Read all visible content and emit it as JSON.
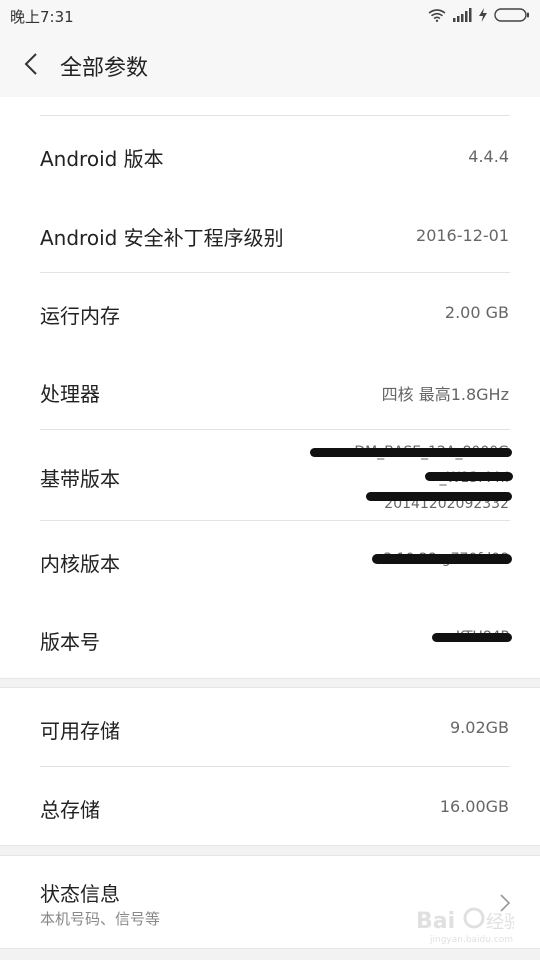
{
  "status_bar": {
    "time": "晚上7:31",
    "icons": [
      "wifi-icon",
      "signal-icon",
      "charging-icon",
      "battery-icon"
    ]
  },
  "header": {
    "title": "全部参数",
    "back_icon": "chevron-left-icon"
  },
  "rows": {
    "android_version": {
      "label": "Android 版本",
      "value": "4.4.4"
    },
    "security_patch": {
      "label": "Android 安全补丁程序级别",
      "value": "2016-12-01"
    },
    "ram": {
      "label": "运行内存",
      "value": "2.00 GB"
    },
    "processor": {
      "label": "处理器",
      "value": "四核 最高1.8GHz"
    },
    "baseband": {
      "label": "基带版本",
      "value_lines": [
        "DM_BASE_12A_8000G",
        "_W13.44.I",
        "20141202092332"
      ]
    },
    "kernel": {
      "label": "内核版本",
      "value": "3.10.28-g770fd08"
    },
    "build_number": {
      "label": "版本号",
      "value": "KTU84P"
    },
    "available_storage": {
      "label": "可用存储",
      "value": "9.02GB"
    },
    "total_storage": {
      "label": "总存储",
      "value": "16.00GB"
    },
    "status_info": {
      "label": "状态信息",
      "sublabel": "本机号码、信号等"
    }
  },
  "colors": {
    "background": "#f2f2f2",
    "panel": "#ffffff",
    "label": "#222222",
    "value": "#666666",
    "redaction": "#111111"
  }
}
